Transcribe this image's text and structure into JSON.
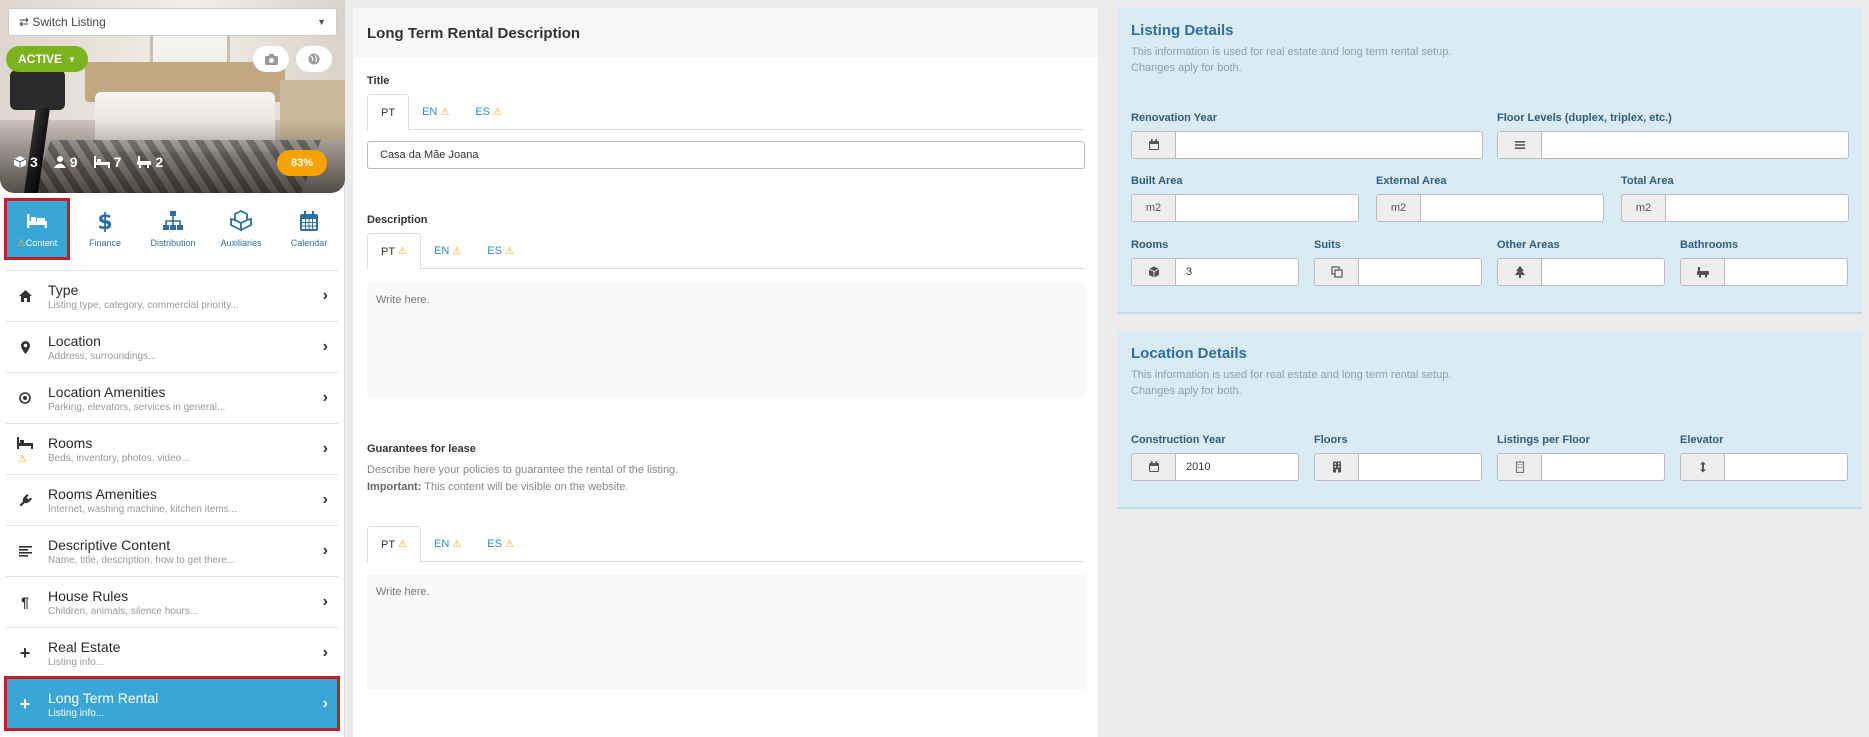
{
  "sidebar": {
    "switch_listing": "⇄ Switch Listing",
    "status": "ACTIVE",
    "stats": [
      {
        "icon": "cube-icon",
        "value": "3"
      },
      {
        "icon": "guests-icon",
        "value": "9"
      },
      {
        "icon": "bed-icon",
        "value": "7"
      },
      {
        "icon": "bath-icon",
        "value": "2"
      }
    ],
    "progress": "83%",
    "section_tabs": [
      {
        "label": "Content",
        "icon": "bed-icon",
        "active": true,
        "warning": true
      },
      {
        "label": "Finance",
        "icon": "dollar-icon",
        "active": false
      },
      {
        "label": "Distribution",
        "icon": "sitemap-icon",
        "active": false
      },
      {
        "label": "Auxiliaries",
        "icon": "cubes-icon",
        "active": false
      },
      {
        "label": "Calendar",
        "icon": "calendar-icon",
        "active": false
      }
    ],
    "menu": [
      {
        "title": "Type",
        "subtitle": "Listing type, category, commercial priority...",
        "icon": "home-icon"
      },
      {
        "title": "Location",
        "subtitle": "Address, surroundings...",
        "icon": "map-pin-icon"
      },
      {
        "title": "Location Amenities",
        "subtitle": "Parking, elevators, services in general...",
        "icon": "target-icon"
      },
      {
        "title": "Rooms",
        "subtitle": "Beds, inventory, photos, video...",
        "icon": "bed-icon",
        "warning": true
      },
      {
        "title": "Rooms Amenities",
        "subtitle": "Internet, washing machine, kitchen items...",
        "icon": "plug-icon"
      },
      {
        "title": "Descriptive Content",
        "subtitle": "Name, title, description, how to get there...",
        "icon": "align-left-icon"
      },
      {
        "title": "House Rules",
        "subtitle": "Children, animals, silence hours...",
        "icon": "paragraph-icon"
      },
      {
        "title": "Real Estate",
        "subtitle": "Listing info...",
        "icon": "plus-icon"
      },
      {
        "title": "Long Term Rental",
        "subtitle": "Listing info...",
        "icon": "plus-icon",
        "active": true
      }
    ]
  },
  "description_panel": {
    "heading": "Long Term Rental Description",
    "title_label": "Title",
    "title_tabs": [
      {
        "label": "PT",
        "warning": false,
        "active": true
      },
      {
        "label": "EN",
        "warning": true,
        "active": false
      },
      {
        "label": "ES",
        "warning": true,
        "active": false
      }
    ],
    "title_value": "Casa da Mãe Joana",
    "description_label": "Description",
    "description_tabs": [
      {
        "label": "PT",
        "warning": true,
        "active": true
      },
      {
        "label": "EN",
        "warning": true,
        "active": false
      },
      {
        "label": "ES",
        "warning": true,
        "active": false
      }
    ],
    "description_placeholder": "Write here.",
    "guarantees_label": "Guarantees for lease",
    "guarantees_help": "Describe here your policies to guarantee the rental of the listing.",
    "guarantees_important_label": "Important:",
    "guarantees_important_text": " This content will be visible on the website.",
    "guarantees_tabs": [
      {
        "label": "PT",
        "warning": true,
        "active": true
      },
      {
        "label": "EN",
        "warning": true,
        "active": false
      },
      {
        "label": "ES",
        "warning": true,
        "active": false
      }
    ],
    "guarantees_placeholder": "Write here."
  },
  "listing_details": {
    "heading": "Listing Details",
    "subtitle_line1": "This information is used for real estate and long term rental setup.",
    "subtitle_line2": "Changes aply for both.",
    "renovation_year": {
      "label": "Renovation Year",
      "value": ""
    },
    "floor_levels": {
      "label": "Floor Levels (duplex, triplex, etc.)",
      "value": ""
    },
    "built_area": {
      "label": "Built Area",
      "unit": "m2",
      "value": ""
    },
    "external_area": {
      "label": "External Area",
      "unit": "m2",
      "value": ""
    },
    "total_area": {
      "label": "Total Area",
      "unit": "m2",
      "value": ""
    },
    "rooms": {
      "label": "Rooms",
      "value": "3"
    },
    "suits": {
      "label": "Suits",
      "value": ""
    },
    "other_areas": {
      "label": "Other Areas",
      "value": ""
    },
    "bathrooms": {
      "label": "Bathrooms",
      "value": ""
    }
  },
  "location_details": {
    "heading": "Location Details",
    "subtitle_line1": "This information is used for real estate and long term rental setup.",
    "subtitle_line2": "Changes aply for both.",
    "construction_year": {
      "label": "Construction Year",
      "value": "2010"
    },
    "floors": {
      "label": "Floors",
      "value": ""
    },
    "listings_per_floor": {
      "label": "Listings per Floor",
      "value": ""
    },
    "elevator": {
      "label": "Elevator",
      "value": ""
    }
  },
  "colors": {
    "accent": "#3aa6d8",
    "status_active": "#7bb31f",
    "warning": "#f5a300",
    "highlight_border": "#c0202a",
    "info_panel_bg": "#d9ebf5"
  }
}
